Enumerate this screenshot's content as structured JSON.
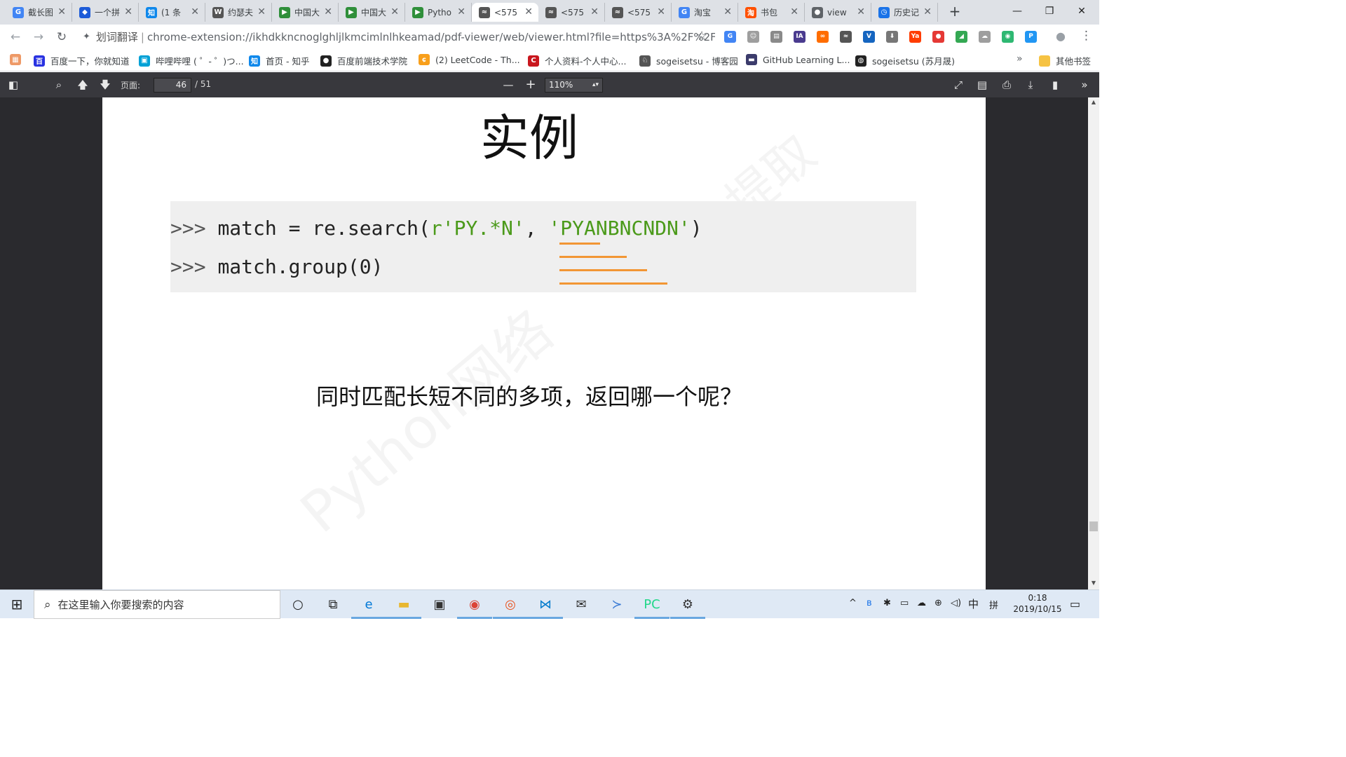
{
  "tabs": [
    {
      "title": "截长图",
      "favicon": "G",
      "color": "#4285f4",
      "active": false
    },
    {
      "title": "一个拼",
      "favicon": "◆",
      "color": "#1d5bd8",
      "active": false
    },
    {
      "title": "(1 条",
      "favicon": "知",
      "color": "#0f88eb",
      "active": false
    },
    {
      "title": "约瑟夫",
      "favicon": "W",
      "color": "#555555",
      "active": false
    },
    {
      "title": "中国大",
      "favicon": "▶",
      "color": "#2f8f3a",
      "active": false
    },
    {
      "title": "中国大",
      "favicon": "▶",
      "color": "#2f8f3a",
      "active": false
    },
    {
      "title": "Pytho",
      "favicon": "▶",
      "color": "#2f8f3a",
      "active": false
    },
    {
      "title": "<575",
      "favicon": "≈",
      "color": "#555555",
      "active": true
    },
    {
      "title": "<575",
      "favicon": "≈",
      "color": "#555555",
      "active": false
    },
    {
      "title": "<575",
      "favicon": "≈",
      "color": "#555555",
      "active": false
    },
    {
      "title": "淘宝",
      "favicon": "G",
      "color": "#4285f4",
      "active": false
    },
    {
      "title": "书包",
      "favicon": "淘",
      "color": "#ff5000",
      "active": false
    },
    {
      "title": "view",
      "favicon": "●",
      "color": "#5f6368",
      "active": false
    },
    {
      "title": "历史记",
      "favicon": "◷",
      "color": "#1a73e8",
      "active": false
    }
  ],
  "window_controls": {
    "minimize": "—",
    "restore": "❐",
    "close": "✕"
  },
  "toolbar": {
    "back": "←",
    "forward": "→",
    "reload": "↻",
    "extension_label": "划词翻译",
    "url": "chrome-extension://ikhdkkncnoglghljlkmcimlnlhkeamad/pdf-viewer/web/viewer.html?file=https%3A%2F%2F...",
    "star": "☆",
    "profile": "●",
    "menu": "⋮"
  },
  "extensions": [
    {
      "name": "translate-icon",
      "glyph": "G",
      "color": "#4285f4"
    },
    {
      "name": "cat-icon",
      "glyph": "☺",
      "color": "#9e9e9e"
    },
    {
      "name": "reader-icon",
      "glyph": "▤",
      "color": "#8a8a8a"
    },
    {
      "name": "ia-icon",
      "glyph": "IA",
      "color": "#4a3b8f"
    },
    {
      "name": "infinity-icon",
      "glyph": "∞",
      "color": "#ff6d00"
    },
    {
      "name": "en-icon",
      "glyph": "≈",
      "color": "#555555"
    },
    {
      "name": "v-icon",
      "glyph": "V",
      "color": "#1565c0"
    },
    {
      "name": "download-icon",
      "glyph": "⬇",
      "color": "#777777"
    },
    {
      "name": "ya-icon",
      "glyph": "Ya",
      "color": "#ff3d00"
    },
    {
      "name": "adblock-icon",
      "glyph": "●",
      "color": "#e53935"
    },
    {
      "name": "drive-icon",
      "glyph": "◢",
      "color": "#34a853"
    },
    {
      "name": "cloud-icon",
      "glyph": "☁",
      "color": "#9e9e9e"
    },
    {
      "name": "green-icon",
      "glyph": "◉",
      "color": "#2eb872"
    },
    {
      "name": "p-icon",
      "glyph": "P",
      "color": "#2196f3"
    }
  ],
  "bookmarks": [
    {
      "label": "",
      "favicon": "▦",
      "color": "#e96"
    },
    {
      "label": "百度一下，你就知道",
      "favicon": "百",
      "color": "#2932e1"
    },
    {
      "label": "哔哩哔哩 ( ゜- ゜)つ...",
      "favicon": "▣",
      "color": "#00a1d6"
    },
    {
      "label": "首页 - 知乎",
      "favicon": "知",
      "color": "#0f88eb"
    },
    {
      "label": "百度前端技术学院",
      "favicon": "●",
      "color": "#222222"
    },
    {
      "label": "(2) LeetCode - Th...",
      "favicon": "ɕ",
      "color": "#f89f1b"
    },
    {
      "label": "个人资料-个人中心...",
      "favicon": "C",
      "color": "#c9171e"
    },
    {
      "label": "sogeisetsu - 博客园",
      "favicon": "♘",
      "color": "#555555"
    },
    {
      "label": "GitHub Learning L...",
      "favicon": "▬",
      "color": "#3b3b6b"
    },
    {
      "label": "sogeisetsu (苏月晟)",
      "favicon": "◍",
      "color": "#222222"
    }
  ],
  "bookmarks_more": "»",
  "other_bookmarks": "其他书签",
  "pdf_toolbar": {
    "page_label": "页面:",
    "page_current": "46",
    "page_total": "/ 51",
    "zoom": "110%",
    "zoom_out": "—",
    "zoom_in": "+"
  },
  "slide": {
    "title": "实例",
    "code_line1": {
      "prompt": ">>> ",
      "code": "match = re.search(",
      "str1": "r'PY.*N'",
      "sep": ", ",
      "str2": "'PYANBNCNDN'",
      "close": ")"
    },
    "code_line2": {
      "prompt": ">>> ",
      "code": "match.group(0)"
    },
    "question": "同时匹配长短不同的多项，返回哪一个呢？",
    "watermark": "Python网络",
    "watermark2": "提取"
  },
  "taskbar": {
    "start": "⊞",
    "search_placeholder": "在这里输入你要搜索的内容",
    "apps": [
      {
        "name": "cortana-icon",
        "glyph": "○",
        "color": "#222222",
        "open": false
      },
      {
        "name": "task-view-icon",
        "glyph": "⧉",
        "color": "#222222",
        "open": false
      },
      {
        "name": "edge-icon",
        "glyph": "e",
        "color": "#0078d7",
        "open": true
      },
      {
        "name": "explorer-icon",
        "glyph": "▬",
        "color": "#e8b730",
        "open": true
      },
      {
        "name": "store-icon",
        "glyph": "▣",
        "color": "#333333",
        "open": false
      },
      {
        "name": "chrome-icon",
        "glyph": "◉",
        "color": "#db4437",
        "open": true
      },
      {
        "name": "ubuntu-icon",
        "glyph": "◎",
        "color": "#e95420",
        "open": true
      },
      {
        "name": "vscode-icon",
        "glyph": "⋈",
        "color": "#007acc",
        "open": true
      },
      {
        "name": "mail-icon",
        "glyph": "✉",
        "color": "#333333",
        "open": false
      },
      {
        "name": "powershell-icon",
        "glyph": "≻",
        "color": "#3a7bd5",
        "open": false
      },
      {
        "name": "pycharm-icon",
        "glyph": "PC",
        "color": "#21d789",
        "open": true
      },
      {
        "name": "settings-icon",
        "glyph": "⚙",
        "color": "#333333",
        "open": true
      }
    ],
    "tray": {
      "chevron": "^",
      "bluetooth": "ʙ",
      "tray2": "✱",
      "battery": "▭",
      "onedrive": "☁",
      "network": "⊕",
      "volume": "◁)",
      "ime": "中",
      "ime2": "拼"
    },
    "time": "0:18",
    "date": "2019/10/15",
    "notification": "▭"
  }
}
